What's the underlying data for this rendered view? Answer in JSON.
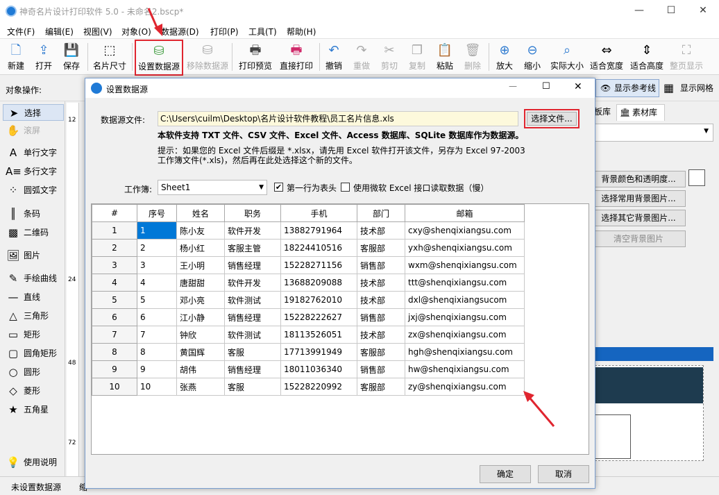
{
  "app": {
    "title": "神奇名片设计打印软件 5.0 - 未命名2.bscp*"
  },
  "menu": [
    "文件(F)",
    "编辑(E)",
    "视图(V)",
    "对象(O)",
    "数据源(D)",
    "打印(P)",
    "工具(T)",
    "帮助(H)"
  ],
  "toolbar": {
    "new": "新建",
    "open": "打开",
    "save": "保存",
    "card_size": "名片尺寸",
    "set_datasource": "设置数据源",
    "remove_datasource": "移除数据源",
    "print_preview": "打印预览",
    "direct_print": "直接打印",
    "undo": "撤销",
    "redo": "重做",
    "cut": "剪切",
    "copy": "复制",
    "paste": "粘贴",
    "delete": "删除",
    "zoom_in": "放大",
    "zoom_out": "缩小",
    "actual_size": "实际大小",
    "fit_width": "适合宽度",
    "fit_height": "适合高度",
    "full_page": "整页显示"
  },
  "objbar": {
    "label": "对象操作:",
    "show_guides": "显示参考线",
    "show_grid": "显示网格"
  },
  "tools": {
    "select": "选择",
    "scroll": "滚屏",
    "single_text": "单行文字",
    "multi_text": "多行文字",
    "arc_text": "圆弧文字",
    "barcode": "条码",
    "qrcode": "二维码",
    "image": "图片",
    "freehand": "手绘曲线",
    "line": "直线",
    "triangle": "三角形",
    "rect": "矩形",
    "round_rect": "圆角矩形",
    "circle": "圆形",
    "diamond": "菱形",
    "star": "五角星",
    "help": "使用说明"
  },
  "ruler": {
    "marks": [
      "12",
      "24",
      "48",
      "72"
    ]
  },
  "rightpanel": {
    "tab_template": "板库",
    "tab_material": "素材库",
    "bg_color_btn": "背景颜色和透明度...",
    "common_bg_btn": "选择常用背景图片...",
    "other_bg_btn": "选择其它背景图片...",
    "clear_bg_btn": "清空背景图片"
  },
  "status": {
    "datasource": "未设置数据源",
    "extra": "缩"
  },
  "dialog": {
    "title": "设置数据源",
    "file_label": "数据源文件:",
    "file_path": "C:\\Users\\cuilm\\Desktop\\名片设计软件教程\\员工名片信息.xls",
    "choose_file": "选择文件...",
    "support_note": "本软件支持 TXT 文件、CSV 文件、Excel 文件、Access 数据库、SQLite 数据库作为数据源。",
    "tip_line1": "提示：如果您的 Excel 文件后缀是 *.xlsx，请先用 Excel 软件打开该文件，另存为 Excel 97-2003",
    "tip_line2": "工作簿文件(*.xls)，然后再在此处选择这个新的文件。",
    "sheet_label": "工作簿:",
    "sheet_value": "Sheet1",
    "first_row_header": "第一行为表头",
    "first_row_checked": true,
    "use_ms_excel": "使用微软 Excel 接口读取数据（慢）",
    "use_ms_checked": false,
    "ok": "确定",
    "cancel": "取消"
  },
  "table": {
    "columns": [
      "#",
      "序号",
      "姓名",
      "职务",
      "手机",
      "部门",
      "邮箱"
    ],
    "rows": [
      [
        "1",
        "1",
        "陈小友",
        "软件开发",
        "13882791964",
        "技术部",
        "cxy@shenqixiangsu.com"
      ],
      [
        "2",
        "2",
        "杨小红",
        "客服主管",
        "18224410516",
        "客服部",
        "yxh@shenqixiangsu.com"
      ],
      [
        "3",
        "3",
        "王小明",
        "销售经理",
        "15228271156",
        "销售部",
        "wxm@shenqixiangsu.com"
      ],
      [
        "4",
        "4",
        "唐甜甜",
        "软件开发",
        "13688209088",
        "技术部",
        "ttt@shenqixiangsu.com"
      ],
      [
        "5",
        "5",
        "邓小亮",
        "软件测试",
        "19182762010",
        "技术部",
        "dxl@shenqixiangsucom"
      ],
      [
        "6",
        "6",
        "江小静",
        "销售经理",
        "15228222627",
        "销售部",
        "jxj@shenqixiangsu.com"
      ],
      [
        "7",
        "7",
        "钟欣",
        "软件测试",
        "18113526051",
        "技术部",
        "zx@shenqixiangsu.com"
      ],
      [
        "8",
        "8",
        "黄国辉",
        "客服",
        "17713991949",
        "客服部",
        "hgh@shenqixiangsu.com"
      ],
      [
        "9",
        "9",
        "胡伟",
        "销售经理",
        "18011036340",
        "销售部",
        "hw@shenqixiangsu.com"
      ],
      [
        "10",
        "10",
        "张燕",
        "客服",
        "15228220992",
        "客服部",
        "zy@shenqixiangsu.com"
      ]
    ]
  },
  "colors": {
    "accent": "#0078d7",
    "highlight_red": "#e0252f"
  }
}
